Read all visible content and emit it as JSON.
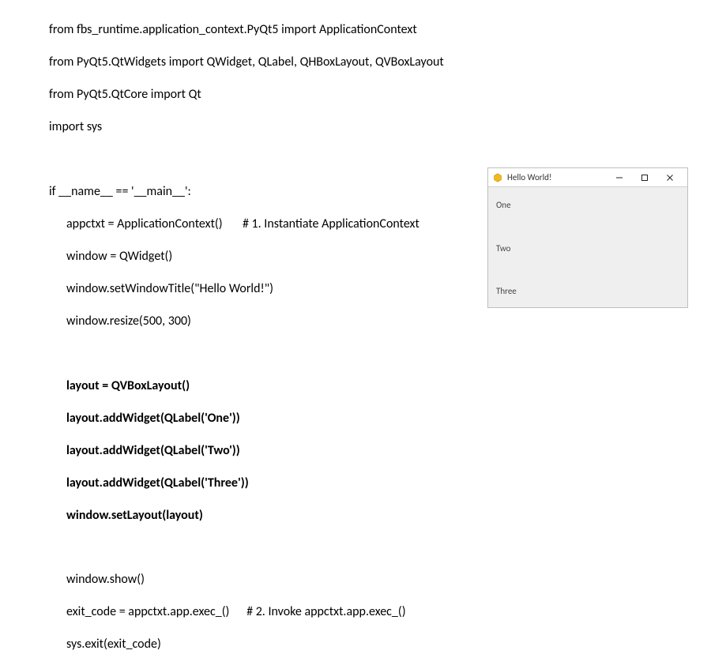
{
  "code": {
    "import1": "from fbs_runtime.application_context.PyQt5 import ApplicationContext",
    "import2": "from PyQt5.QtWidgets import QWidget, QLabel, QHBoxLayout, QVBoxLayout",
    "import3": "from PyQt5.QtCore import Qt",
    "import4": "import sys",
    "if_line": "if __name__ == '__main__':",
    "l1": "appctxt = ApplicationContext()       # 1. Instantiate ApplicationContext",
    "l2": "window = QWidget()",
    "l3": "window.setWindowTitle(\"Hello World!\")",
    "l4": "window.resize(500, 300)",
    "b1": "layout = QVBoxLayout()",
    "b2": "layout.addWidget(QLabel('One'))",
    "b3": "layout.addWidget(QLabel('Two'))",
    "b4": "layout.addWidget(QLabel('Three'))",
    "b5": "window.setLayout(layout)",
    "l5": "window.show()",
    "l6": "exit_code = appctxt.app.exec_()      # 2. Invoke appctxt.app.exec_()",
    "l7": "sys.exit(exit_code)"
  },
  "window": {
    "title": "Hello World!",
    "labels": {
      "one": "One",
      "two": "Two",
      "three": "Three"
    }
  }
}
